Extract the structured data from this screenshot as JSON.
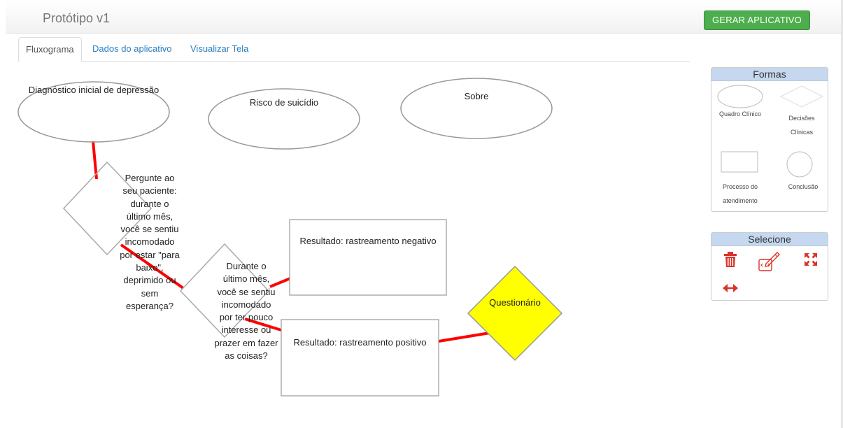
{
  "header": {
    "app_title": "Protótipo v1",
    "generate_button": "GERAR APLICATIVO"
  },
  "tabs": [
    {
      "label": "Fluxograma",
      "active": true
    },
    {
      "label": "Dados do aplicativo",
      "active": false
    },
    {
      "label": "Visualizar Tela",
      "active": false
    }
  ],
  "flow": {
    "node_1": "Diagnóstico inicial de depressão",
    "node_2": "Risco de suicídio",
    "node_3": "Sobre",
    "decision_1": [
      "Pergunte ao",
      "seu paciente:",
      "durante o",
      "último mês,",
      "você se sentiu",
      "incomodado",
      "por estar \"para",
      "baixo\",",
      "deprimido ou",
      "sem",
      "esperança?"
    ],
    "decision_2": [
      "Durante o",
      "último mês,",
      "você se sentiu",
      "incomodado",
      "por ter pouco",
      "interesse ou",
      "prazer em fazer",
      "as coisas?"
    ],
    "result_negative": "Resultado: rastreamento negativo",
    "result_positive": "Resultado: rastreamento positivo",
    "questionnaire": "Questionário"
  },
  "shapes_panel": {
    "title": "Formas",
    "items": [
      {
        "label": "Quadro Clínico",
        "icon": "ellipse-shape-icon"
      },
      {
        "label_lines": [
          "Decisões",
          "Clínicas"
        ],
        "icon": "diamond-shape-icon"
      },
      {
        "label_lines": [
          "Processo do",
          "atendimento"
        ],
        "icon": "rectangle-shape-icon"
      },
      {
        "label": "Conclusão",
        "icon": "circle-shape-icon"
      }
    ]
  },
  "select_panel": {
    "title": "Selecione",
    "tools": [
      "trash-icon",
      "edit-code-icon",
      "expand-arrows-icon",
      "horizontal-resize-icon"
    ]
  },
  "colors": {
    "connector": "#ff0000",
    "questionnaire_fill": "#ffff00",
    "button_green": "#4cae4c",
    "panel_header": "#c5d8ef",
    "tool_red": "#d9342b",
    "link_blue": "#2a7fc1"
  }
}
